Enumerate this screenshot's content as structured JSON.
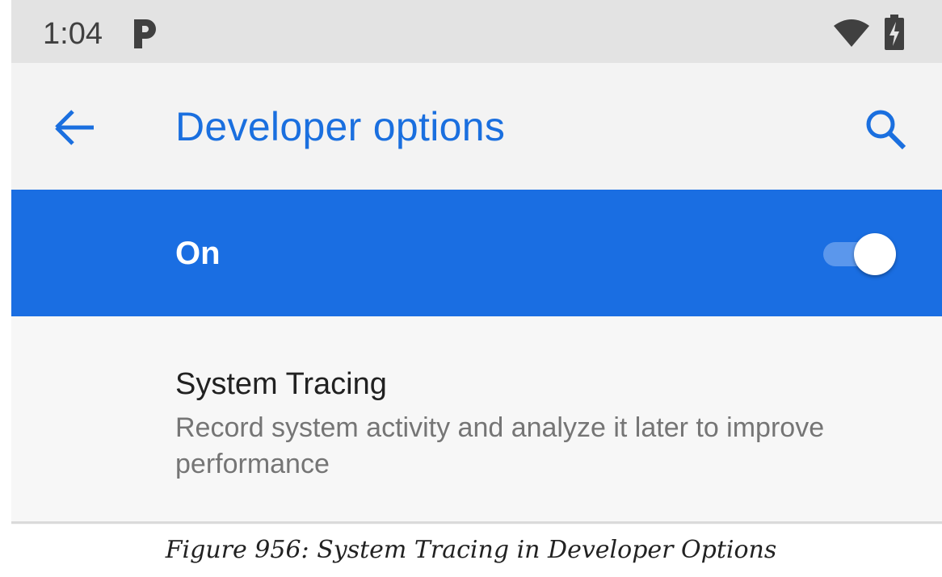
{
  "status_bar": {
    "time": "1:04",
    "notification_icon": "pandora-p-icon",
    "wifi_icon": "wifi-icon",
    "battery_icon": "battery-charging-icon"
  },
  "app_bar": {
    "back_icon": "arrow-back-icon",
    "title": "Developer options",
    "search_icon": "search-icon"
  },
  "master_switch": {
    "label": "On",
    "checked": true
  },
  "preferences": [
    {
      "title": "System Tracing",
      "summary": "Record system activity and analyze it later to improve performance"
    }
  ],
  "caption": "Figure 956: System Tracing in Developer Options",
  "colors": {
    "accent": "#1a6fdf",
    "master_bar": "#1a6ee2",
    "status_bar": "#e3e3e3",
    "app_bar": "#f3f3f3",
    "toggle_track": "#5b97ec"
  }
}
